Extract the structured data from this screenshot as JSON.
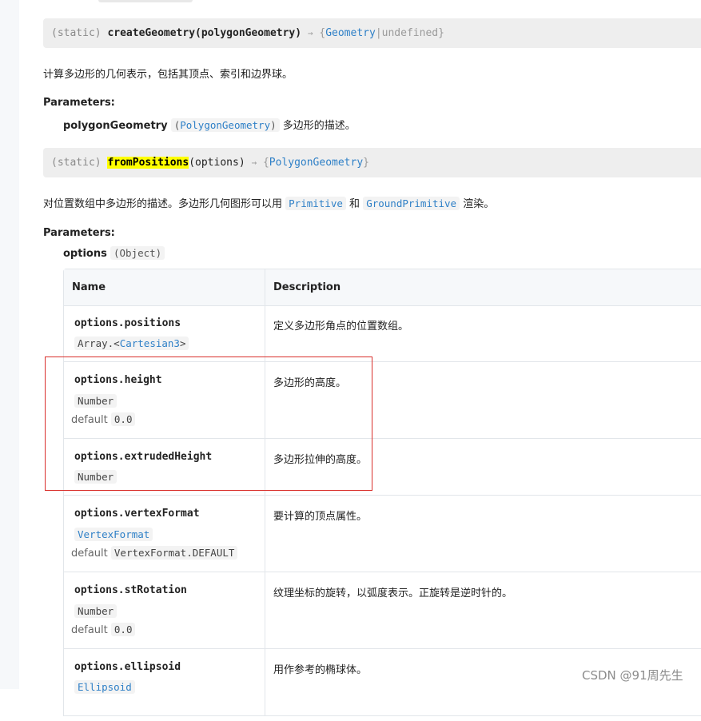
{
  "sig1": {
    "static": "(static)",
    "name": "createGeometry(polygonGeometry)",
    "arrow": "→",
    "open": "{",
    "type": "Geometry",
    "sep": "|",
    "undef": "undefined",
    "close": "}"
  },
  "desc1": "计算多边形的几何表示，包括其顶点、索引和边界球。",
  "params1": {
    "title": "Parameters:",
    "name": "polygonGeometry",
    "type_open": "(",
    "type": "PolygonGeometry",
    "type_close": ")",
    "desc": "多边形的描述。"
  },
  "sig2": {
    "static": "(static)",
    "name": "fromPositions",
    "args": "(options)",
    "arrow": "→",
    "open": "{",
    "type": "PolygonGeometry",
    "close": "}"
  },
  "desc2": {
    "pre": "对位置数组中多边形的描述。多边形几何图形可以用",
    "link1": "Primitive",
    "mid": "和",
    "link2": "GroundPrimitive",
    "post": "渲染。"
  },
  "params2": {
    "title": "Parameters:",
    "name": "options",
    "type": "(Object)"
  },
  "table": {
    "headers": {
      "name": "Name",
      "description": "Description"
    },
    "rows": [
      {
        "name": "options.positions",
        "type_prefix": "Array.<",
        "type_link": "Cartesian3",
        "type_suffix": ">",
        "description": "定义多边形角点的位置数组。"
      },
      {
        "name": "options.height",
        "type": "Number",
        "default_label": "default",
        "default": "0.0",
        "description": "多边形的高度。"
      },
      {
        "name": "options.extrudedHeight",
        "type": "Number",
        "description": "多边形拉伸的高度。"
      },
      {
        "name": "options.vertexFormat",
        "type": "VertexFormat",
        "default_label": "default",
        "default": "VertexFormat.DEFAULT",
        "description": "要计算的顶点属性。"
      },
      {
        "name": "options.stRotation",
        "type": "Number",
        "default_label": "default",
        "default": "0.0",
        "description": "纹理坐标的旋转，以弧度表示。正旋转是逆时针的。"
      },
      {
        "name": "options.ellipsoid",
        "type": "Ellipsoid",
        "description": "用作参考的椭球体。"
      }
    ]
  },
  "watermark": "CSDN @91周先生",
  "colors": {
    "link": "#2f80c7",
    "highlight": "#ffff00",
    "annotation_box": "#d9302c"
  }
}
